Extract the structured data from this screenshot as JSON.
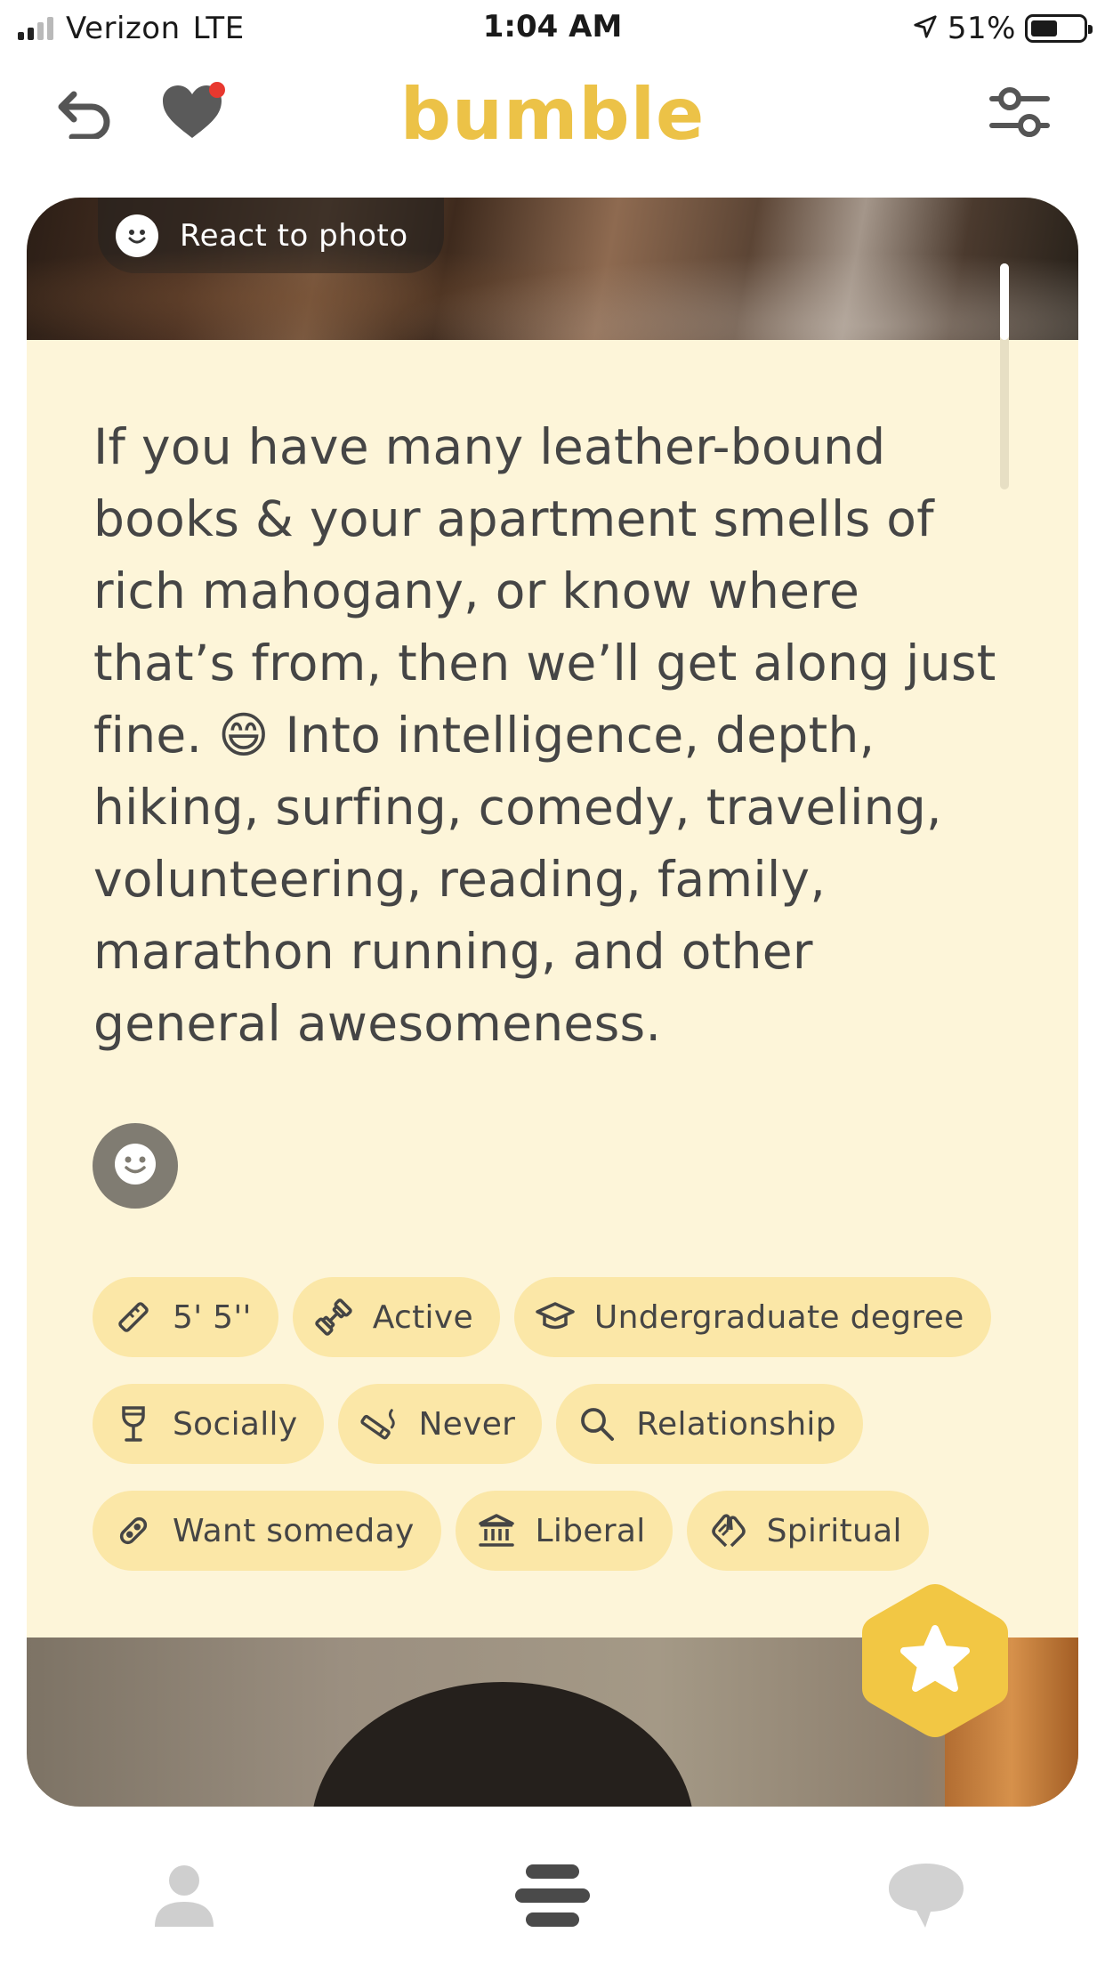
{
  "status_bar": {
    "carrier": "Verizon",
    "network": "LTE",
    "time": "1:04 AM",
    "battery": "51%",
    "signal_bars_active": 2,
    "signal_bars_total": 4
  },
  "header": {
    "logo": "bumble",
    "back_icon": "undo-arrow-icon",
    "likes_icon": "heart-with-notification-icon",
    "filters_icon": "sliders-filter-icon",
    "brand_color": "#ecc247",
    "notification_dot_color": "#e8382f"
  },
  "card": {
    "react_to_photo_label": "React to photo",
    "bio": "If you have many leather-bound books & your apartment smells of rich mahogany, or know where that’s from, then we’ll get along just fine. 😄 Into intelligence, depth, hiking, surfing, comedy, traveling, volunteering, reading, family, marathon running, and other general awesomeness.",
    "background_color": "#fdf5d9",
    "badge_color": "#fbe7a7",
    "badges": [
      [
        {
          "icon": "ruler-icon",
          "label": "5' 5''"
        },
        {
          "icon": "dumbbell-icon",
          "label": "Active"
        },
        {
          "icon": "graduation-cap-icon",
          "label": "Undergraduate degree"
        }
      ],
      [
        {
          "icon": "wine-glass-icon",
          "label": "Socially"
        },
        {
          "icon": "cigarette-icon",
          "label": "Never"
        },
        {
          "icon": "search-icon",
          "label": "Relationship"
        }
      ],
      [
        {
          "icon": "pacifier-icon",
          "label": "Want someday"
        },
        {
          "icon": "government-building-icon",
          "label": "Liberal"
        },
        {
          "icon": "praying-hands-icon",
          "label": "Spiritual"
        }
      ]
    ]
  },
  "superswipe": {
    "icon": "star-icon",
    "color": "#f2c744"
  },
  "bottom_nav": [
    {
      "icon": "profile-icon"
    },
    {
      "icon": "discover-stack-icon"
    },
    {
      "icon": "chat-bubble-icon"
    }
  ]
}
